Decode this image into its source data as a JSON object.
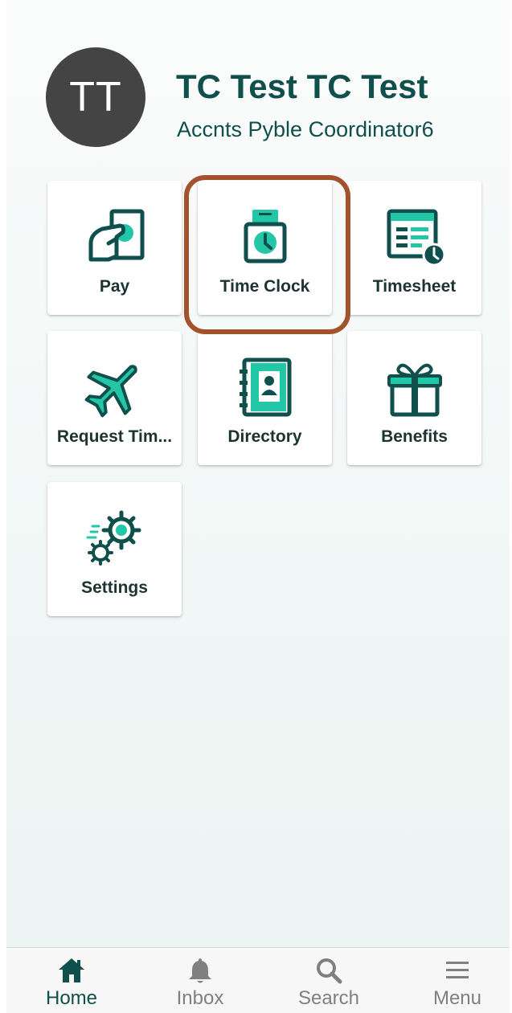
{
  "profile": {
    "initials": "TT",
    "name": "TC Test TC Test",
    "role": "Accnts Pyble Coordinator6"
  },
  "tiles": [
    {
      "label": "Pay",
      "icon": "hand-money-icon"
    },
    {
      "label": "Time Clock",
      "icon": "time-clock-icon",
      "highlighted": true
    },
    {
      "label": "Timesheet",
      "icon": "timesheet-icon"
    },
    {
      "label": "Request Tim...",
      "icon": "airplane-icon"
    },
    {
      "label": "Directory",
      "icon": "address-book-icon"
    },
    {
      "label": "Benefits",
      "icon": "gift-icon"
    },
    {
      "label": "Settings",
      "icon": "gears-icon"
    }
  ],
  "bottom_nav": {
    "items": [
      {
        "label": "Home",
        "icon": "home-icon",
        "active": true
      },
      {
        "label": "Inbox",
        "icon": "bell-icon"
      },
      {
        "label": "Search",
        "icon": "search-icon"
      },
      {
        "label": "Menu",
        "icon": "hamburger-menu-icon"
      }
    ]
  },
  "colors": {
    "primary_dark": "#0f4f4c",
    "accent": "#23c7a7",
    "avatar_bg": "#444444",
    "highlight_ring": "#a3532b",
    "inactive_nav": "#808080"
  }
}
